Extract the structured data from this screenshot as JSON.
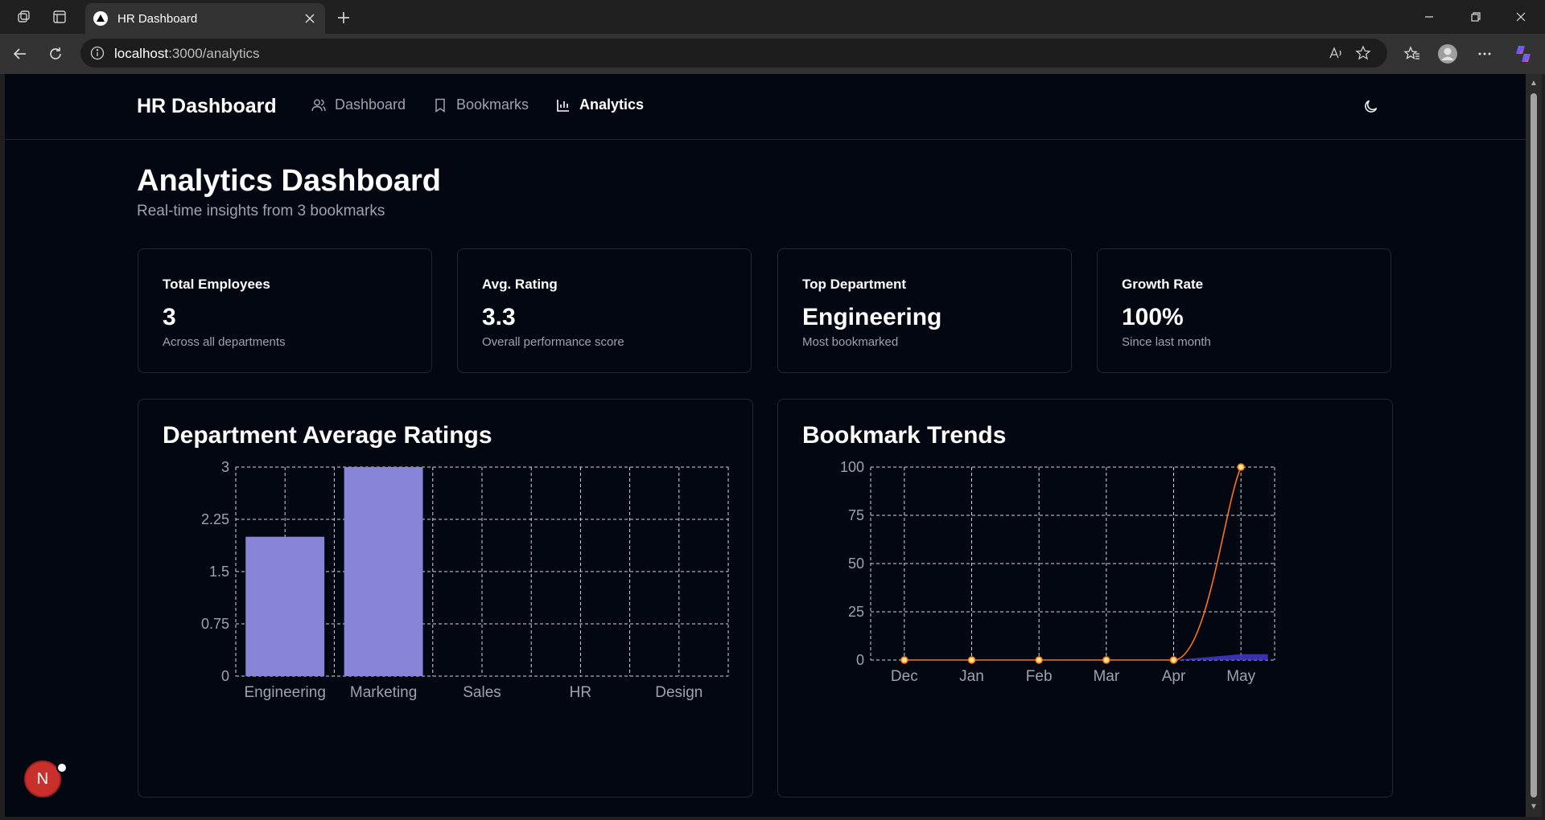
{
  "browser": {
    "tab_title": "HR Dashboard",
    "url_host": "localhost",
    "url_path": ":3000/analytics"
  },
  "header": {
    "brand": "HR Dashboard",
    "nav": [
      {
        "label": "Dashboard",
        "icon": "users-icon",
        "active": false
      },
      {
        "label": "Bookmarks",
        "icon": "bookmark-icon",
        "active": false
      },
      {
        "label": "Analytics",
        "icon": "bar-chart-icon",
        "active": true
      }
    ],
    "theme_icon": "moon-icon"
  },
  "page": {
    "title": "Analytics Dashboard",
    "subtitle": "Real-time insights from 3 bookmarks"
  },
  "stats": [
    {
      "label": "Total Employees",
      "value": "3",
      "desc": "Across all departments"
    },
    {
      "label": "Avg. Rating",
      "value": "3.3",
      "desc": "Overall performance score"
    },
    {
      "label": "Top Department",
      "value": "Engineering",
      "desc": "Most bookmarked"
    },
    {
      "label": "Growth Rate",
      "value": "100%",
      "desc": "Since last month"
    }
  ],
  "charts": {
    "ratings_title": "Department Average Ratings",
    "trends_title": "Bookmark Trends"
  },
  "colors": {
    "bar": "#8884d8",
    "line": "#f97316",
    "area": "#4338ca",
    "background": "#030712"
  },
  "chart_data": [
    {
      "type": "bar",
      "title": "Department Average Ratings",
      "categories": [
        "Engineering",
        "Marketing",
        "Sales",
        "HR",
        "Design"
      ],
      "values": [
        2,
        3,
        0,
        0,
        0
      ],
      "yticks": [
        "0",
        "0.75",
        "1.5",
        "2.25",
        "3"
      ],
      "ylim": [
        0,
        3
      ],
      "grid": true
    },
    {
      "type": "line",
      "title": "Bookmark Trends",
      "categories": [
        "Dec",
        "Jan",
        "Feb",
        "Mar",
        "Apr",
        "May"
      ],
      "series": [
        {
          "type": "line",
          "values": [
            0,
            0,
            0,
            0,
            0,
            100
          ]
        },
        {
          "type": "area",
          "values": [
            0,
            0,
            0,
            0,
            0,
            3
          ]
        }
      ],
      "yticks": [
        "0",
        "25",
        "50",
        "75",
        "100"
      ],
      "ylim": [
        0,
        100
      ],
      "grid": true
    }
  ]
}
